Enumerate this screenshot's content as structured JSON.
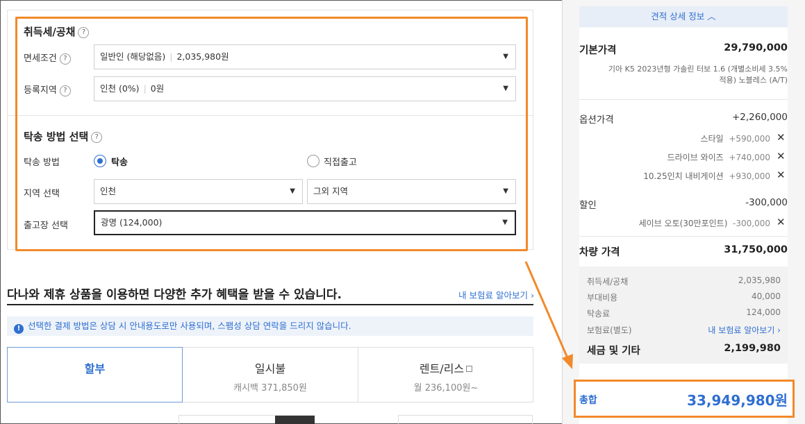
{
  "tax": {
    "title": "취득세/공채",
    "exempt_label": "면세조건",
    "exempt_value": "일반인 (해당없음)",
    "exempt_amount": "2,035,980원",
    "region_label": "등록지역",
    "region_value": "인천 (0%)",
    "region_amount": "0원"
  },
  "delivery": {
    "title": "탁송 방법 선택",
    "method_label": "탁송 방법",
    "option_delivery": "탁송",
    "option_pickup": "직접출고",
    "area_label": "지역 선택",
    "area_value": "인천",
    "area_sub_value": "그외 지역",
    "depot_label": "출고장 선택",
    "depot_value": "광명 (124,000)"
  },
  "promo": {
    "title": "다나와 제휴 상품을 이용하면 다양한 추가 혜택을 받을 수 있습니다.",
    "link": "내 보험료 알아보기 ›",
    "notice": "선택한 결제 방법은 상담 시 안내용도로만 사용되며, 스팸성 상담 연락을 드리지 않습니다."
  },
  "payment_tabs": [
    {
      "title": "할부",
      "sub": ""
    },
    {
      "title": "일시불",
      "sub": "캐시백 371,850원"
    },
    {
      "title": "렌트/리스",
      "sub": "월 236,100원~"
    }
  ],
  "summary": {
    "detail_button": "견적 상세 정보 ︿",
    "base_label": "기본가격",
    "base_value": "29,790,000",
    "model_desc_1": "기아 K5 2023년형 가솔린 터보 1.6 (개별소비세 3.5%",
    "model_desc_2": "적용) 노블레스 (A/T)",
    "option_label": "옵션가격",
    "option_value": "+2,260,000",
    "options": [
      {
        "name": "스타일",
        "price": "+590,000"
      },
      {
        "name": "드라이브 와이즈",
        "price": "+740,000"
      },
      {
        "name": "10.25인치 내비게이션",
        "price": "+930,000"
      }
    ],
    "discount_label": "할인",
    "discount_value": "-300,000",
    "discounts": [
      {
        "name": "세이브 오토(30만포인트)",
        "price": "-300,000"
      }
    ],
    "vehicle_label": "차량 가격",
    "vehicle_value": "31,750,000",
    "tax_items": [
      {
        "name": "취득세/공채",
        "value": "2,035,980"
      },
      {
        "name": "부대비용",
        "value": "40,000"
      },
      {
        "name": "탁송료",
        "value": "124,000"
      }
    ],
    "insurance_label": "보험료(별도)",
    "insurance_link": "내 보험료 알아보기 ›",
    "tax_total_label": "세금 및 기타",
    "tax_total_value": "2,199,980",
    "total_label": "총합",
    "total_value": "33,949,980원"
  },
  "colors": {
    "accent": "#2f6fd0",
    "highlight": "#f2892a"
  }
}
